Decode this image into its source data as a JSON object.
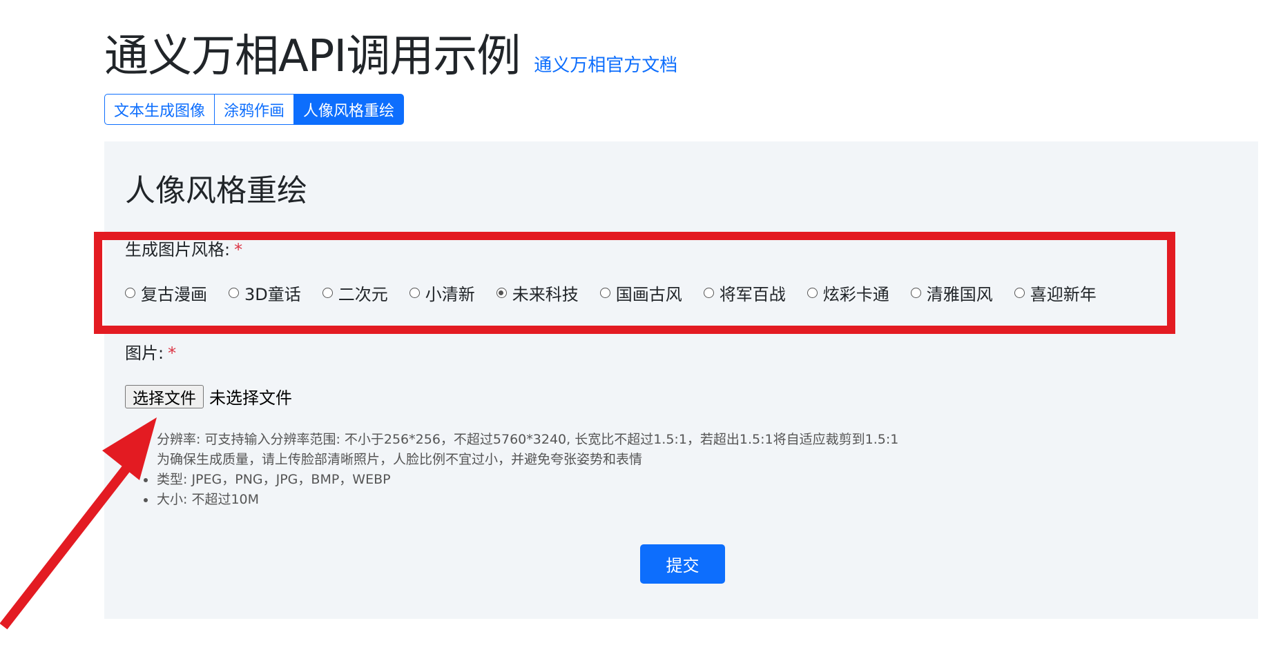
{
  "header": {
    "title": "通义万相API调用示例",
    "doc_link": "通义万相官方文档"
  },
  "tabs": [
    {
      "label": "文本生成图像",
      "active": false
    },
    {
      "label": "涂鸦作画",
      "active": false
    },
    {
      "label": "人像风格重绘",
      "active": true
    }
  ],
  "panel": {
    "title": "人像风格重绘",
    "style_label": "生成图片风格:",
    "required_mark": "*",
    "styles": [
      {
        "label": "复古漫画",
        "checked": false
      },
      {
        "label": "3D童话",
        "checked": false
      },
      {
        "label": "二次元",
        "checked": false
      },
      {
        "label": "小清新",
        "checked": false
      },
      {
        "label": "未来科技",
        "checked": true
      },
      {
        "label": "国画古风",
        "checked": false
      },
      {
        "label": "将军百战",
        "checked": false
      },
      {
        "label": "炫彩卡通",
        "checked": false
      },
      {
        "label": "清雅国风",
        "checked": false
      },
      {
        "label": "喜迎新年",
        "checked": false
      }
    ],
    "image_label": "图片:",
    "file_button": "选择文件",
    "file_status": "未选择文件",
    "hints": {
      "line1": "分辨率: 可支持输入分辨率范围: 不小于256*256，不超过5760*3240, 长宽比不超过1.5:1，若超出1.5:1将自适应裁剪到1.5:1",
      "line2": "为确保生成质量，请上传脸部清晰照片，人脸比例不宜过小，并避免夸张姿势和表情",
      "line3": "类型: JPEG，PNG，JPG，BMP，WEBP",
      "line4": "大小: 不超过10M"
    },
    "submit": "提交"
  },
  "annotation": {
    "color": "#e31b22"
  },
  "colors": {
    "primary": "#0d6efd",
    "required": "#dc3545",
    "panel_bg": "#f2f5f8"
  }
}
